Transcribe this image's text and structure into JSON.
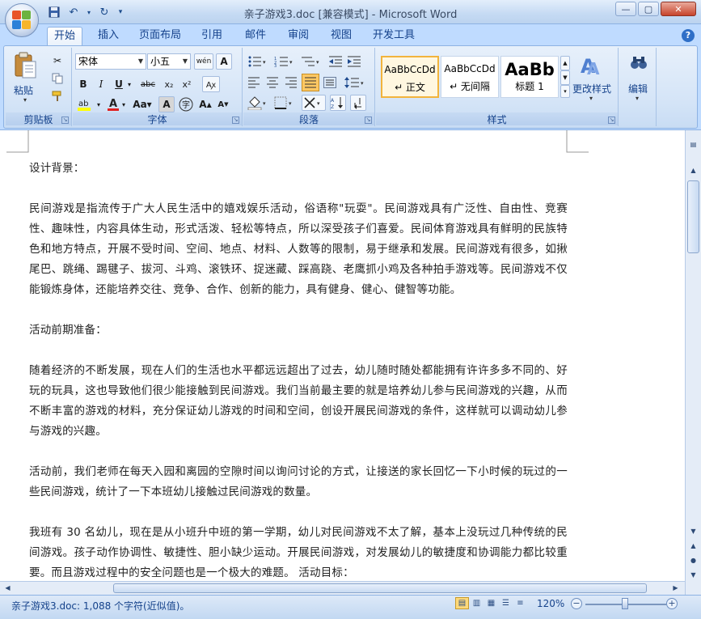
{
  "window": {
    "title": "亲子游戏3.doc [兼容模式] - Microsoft Word"
  },
  "tabs": [
    {
      "label": "开始",
      "active": true
    },
    {
      "label": "插入"
    },
    {
      "label": "页面布局"
    },
    {
      "label": "引用"
    },
    {
      "label": "邮件"
    },
    {
      "label": "审阅"
    },
    {
      "label": "视图"
    },
    {
      "label": "开发工具"
    }
  ],
  "ribbon": {
    "clipboard": {
      "label": "剪贴板",
      "paste_label": "粘贴"
    },
    "font": {
      "label": "字体",
      "font_name": "宋体",
      "font_size": "小五",
      "wen_icon": "wén"
    },
    "paragraph": {
      "label": "段落"
    },
    "styles": {
      "label": "样式",
      "items": [
        {
          "sample": "AaBbCcDd",
          "name": "↵ 正文"
        },
        {
          "sample": "AaBbCcDd",
          "name": "↵ 无间隔"
        },
        {
          "sample": "AaBb",
          "name": "标题 1"
        }
      ],
      "change_styles_label": "更改样式"
    },
    "editing": {
      "label": "编辑"
    }
  },
  "document": {
    "paragraphs": [
      "设计背景：",
      "民间游戏是指流传于广大人民生活中的嬉戏娱乐活动，俗语称\"玩耍\"。民间游戏具有广泛性、自由性、竞赛性、趣味性，内容具体生动，形式活泼、轻松等特点，所以深受孩子们喜爱。民间体育游戏具有鲜明的民族特色和地方特点，开展不受时间、空间、地点、材料、人数等的限制，易于继承和发展。民间游戏有很多，如揪尾巴、跳绳、踢毽子、拔河、斗鸡、滚铁环、捉迷藏、踩高跷、老鹰抓小鸡及各种拍手游戏等。民间游戏不仅能锻炼身体，还能培养交往、竞争、合作、创新的能力，具有健身、健心、健智等功能。",
      "活动前期准备：",
      "随着经济的不断发展，现在人们的生活也水平都远远超出了过去，幼儿随时随处都能拥有许许多多不同的、好玩的玩具，这也导致他们很少能接触到民间游戏。我们当前最主要的就是培养幼儿参与民间游戏的兴趣，从而不断丰富的游戏的材料，充分保证幼儿游戏的时间和空间，创设开展民间游戏的条件，这样就可以调动幼儿参与游戏的兴趣。",
      "活动前，我们老师在每天入园和离园的空隙时间以询问讨论的方式，让接送的家长回忆一下小时候的玩过的一些民间游戏，统计了一下本班幼儿接触过民间游戏的数量。",
      "我班有 30 名幼儿，现在是从小班升中班的第一学期，幼儿对民间游戏不太了解，基本上没玩过几种传统的民间游戏。孩子动作协调性、敏捷性、胆小缺少运动。开展民间游戏，对发展幼儿的敏捷度和协调能力都比较重要。而且游戏过程中的安全问题也是一个极大的难题。   活动目标："
    ]
  },
  "status": {
    "doc_info": "亲子游戏3.doc: 1,088 个字符(近似值)。",
    "zoom": "120%"
  }
}
